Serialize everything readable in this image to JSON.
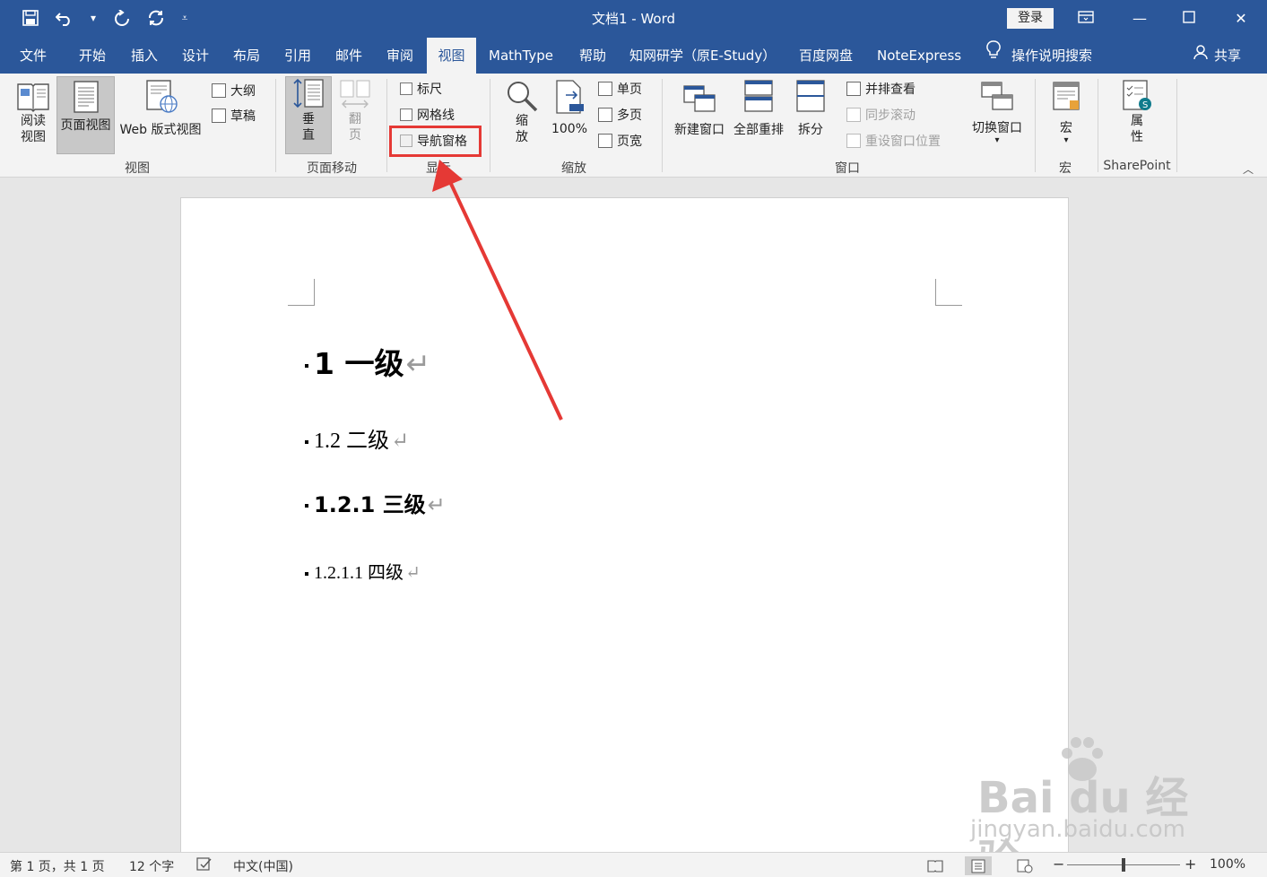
{
  "titlebar": {
    "title": "文档1  -  Word",
    "login": "登录",
    "qat_icons": [
      "save-icon",
      "undo-icon",
      "redo-icon",
      "refresh-icon",
      "customize-icon"
    ]
  },
  "tabs": [
    "文件",
    "开始",
    "插入",
    "设计",
    "布局",
    "引用",
    "邮件",
    "审阅",
    "视图",
    "MathType",
    "帮助",
    "知网研学（原E-Study）",
    "百度网盘",
    "NoteExpress"
  ],
  "active_tab": "视图",
  "tell_me": "操作说明搜索",
  "share": "共享",
  "ribbon": {
    "views": {
      "label": "视图",
      "read_mode": "阅读\n视图",
      "print_layout": "页面视图",
      "web_layout": "Web 版式视图",
      "outline": "大纲",
      "draft": "草稿"
    },
    "page_move": {
      "label": "页面移动",
      "vertical": "垂\n直",
      "side_to_side": "翻\n页"
    },
    "show": {
      "label": "显示",
      "ruler": "标尺",
      "gridlines": "网格线",
      "nav_pane": "导航窗格"
    },
    "zoom": {
      "label": "缩放",
      "zoom": "缩\n放",
      "pct": "100%",
      "one_page": "单页",
      "multi_page": "多页",
      "page_width": "页宽"
    },
    "window": {
      "label": "窗口",
      "new_window": "新建窗口",
      "arrange_all": "全部重排",
      "split": "拆分",
      "side_by_side": "并排查看",
      "sync_scroll": "同步滚动",
      "reset_pos": "重设窗口位置",
      "switch_windows": "切换窗口"
    },
    "macros": {
      "label": "宏",
      "macros": "宏"
    },
    "sharepoint": {
      "label": "SharePoint",
      "properties": "属\n性"
    }
  },
  "document": {
    "h1": "1  一级",
    "h2": "1.2  二级",
    "h3": "1.2.1  三级",
    "h4": "1.2.1.1  四级",
    "return_mark": "↵"
  },
  "statusbar": {
    "page": "第 1 页，共 1 页",
    "words": "12 个字",
    "lang": "中文(中国)",
    "zoom": "100%",
    "zoom_minus": "−",
    "zoom_plus": "+"
  },
  "watermark": {
    "brand": "Bai  du 经验",
    "url": "jingyan.baidu.com"
  }
}
